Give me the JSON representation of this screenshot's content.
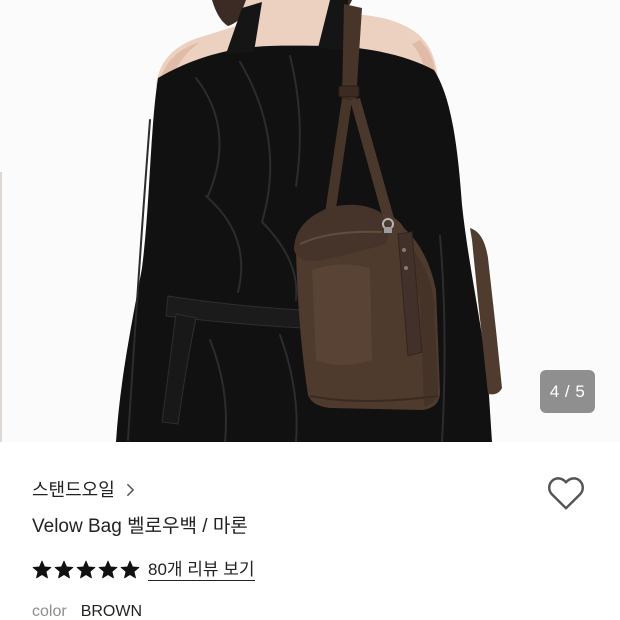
{
  "gallery": {
    "counter": "4 / 5"
  },
  "brand": {
    "name": "스탠드오일",
    "chevron_icon": "chevron-right-icon"
  },
  "wishlist": {
    "icon": "heart-icon",
    "active": false
  },
  "product": {
    "title": "Velow Bag 벨로우백 / 마론"
  },
  "rating": {
    "star_icon": "star-icon",
    "stars_filled": 5,
    "stars_total": 5,
    "reviews_link": "80개 리뷰 보기"
  },
  "option": {
    "label": "color",
    "value": "BROWN"
  },
  "colors": {
    "text": "#222222",
    "muted": "#8e8e8e",
    "badge_bg": "#8f8f8f",
    "star": "#111111",
    "icon": "#555555"
  }
}
